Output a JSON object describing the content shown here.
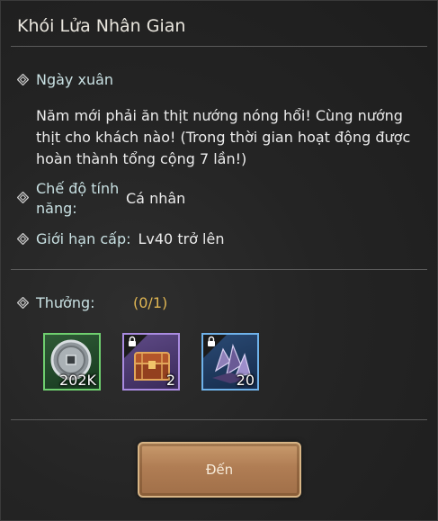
{
  "panel": {
    "title": "Khói Lửa Nhân Gian"
  },
  "event": {
    "name": "Ngày xuân",
    "description_lines": [
      "Năm mới phải ăn thịt nướng nóng hổi! Cùng nướng",
      "thịt cho khách nào! (Trong thời gian hoạt động được",
      "hoàn thành tổng cộng 7 lần!)"
    ]
  },
  "mode": {
    "label_line1": "Chế độ tính",
    "label_line2": "năng:",
    "value": "Cá nhân"
  },
  "level": {
    "label": "Giới hạn cấp:",
    "value": "Lv40 trở lên"
  },
  "rewards": {
    "label": "Thưởng:",
    "progress": "(0/1)",
    "items": [
      {
        "icon": "silver-coin-icon",
        "quantity": "202K",
        "locked": false,
        "border_color": "#6fcf6f"
      },
      {
        "icon": "treasure-chest-icon",
        "quantity": "2",
        "locked": true,
        "border_color": "#a98be0"
      },
      {
        "icon": "purple-crystal-icon",
        "quantity": "20",
        "locked": true,
        "border_color": "#6fb2ea"
      }
    ]
  },
  "action": {
    "go_label": "Đến"
  }
}
